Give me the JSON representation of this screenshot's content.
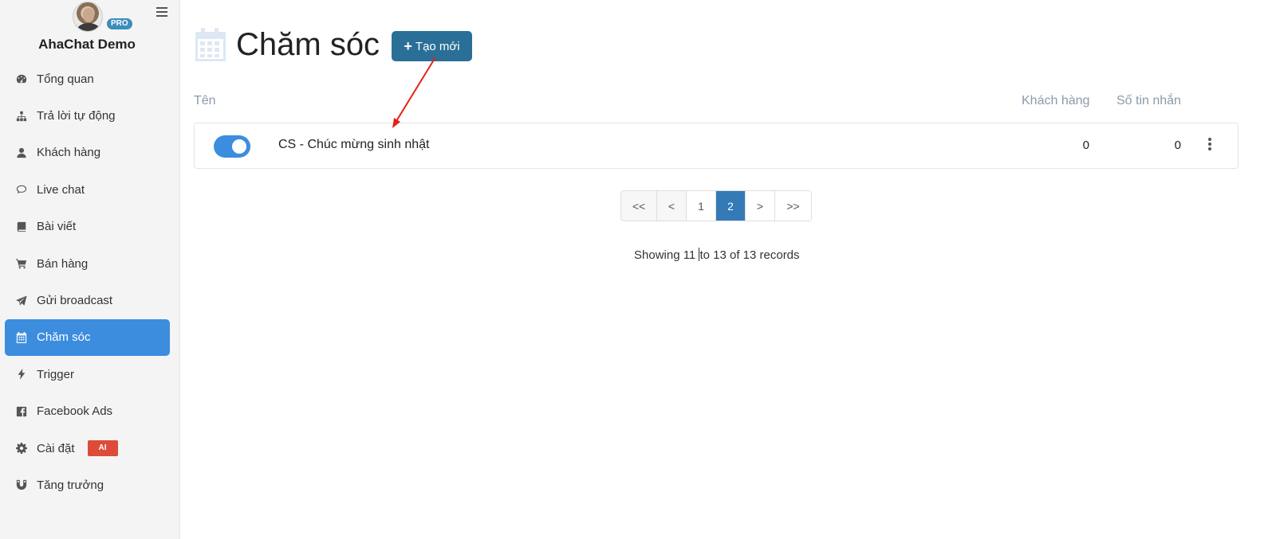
{
  "sidebar": {
    "pro_badge": "PRO",
    "brand": "AhaChat Demo",
    "items": [
      {
        "label": "Tổng quan",
        "icon": "dashboard-icon"
      },
      {
        "label": "Trả lời tự động",
        "icon": "sitemap-icon"
      },
      {
        "label": "Khách hàng",
        "icon": "user-icon"
      },
      {
        "label": "Live chat",
        "icon": "chat-bubble-icon"
      },
      {
        "label": "Bài viết",
        "icon": "book-icon"
      },
      {
        "label": "Bán hàng",
        "icon": "cart-icon"
      },
      {
        "label": "Gửi broadcast",
        "icon": "paper-plane-icon"
      },
      {
        "label": "Chăm sóc",
        "icon": "calendar-icon",
        "active": true
      },
      {
        "label": "Trigger",
        "icon": "bolt-icon"
      },
      {
        "label": "Facebook Ads",
        "icon": "facebook-square-icon"
      },
      {
        "label": "Cài đặt",
        "icon": "gear-icon",
        "badge": "AI"
      },
      {
        "label": "Tăng trưởng",
        "icon": "magnet-icon"
      }
    ]
  },
  "main": {
    "title": "Chăm sóc",
    "create_button": "Tạo mới",
    "columns": {
      "name": "Tên",
      "customers": "Khách hàng",
      "messages": "Số tin nhắn"
    },
    "rows": [
      {
        "enabled": true,
        "name": "CS - Chúc mừng sinh nhật",
        "customers": "0",
        "messages": "0"
      }
    ],
    "pagination": {
      "first": "<<",
      "prev": "<",
      "pages": [
        "1",
        "2"
      ],
      "current": "2",
      "next": ">",
      "last": ">>"
    },
    "showing_before": "Showing 11 ",
    "showing_after": "to 13 of 13 records"
  },
  "colors": {
    "accent": "#3c8dde",
    "create_button": "#2a6f97",
    "current_page": "#337ab7",
    "ai_badge": "#dd4b39",
    "annotation_arrow": "#e8201a"
  }
}
